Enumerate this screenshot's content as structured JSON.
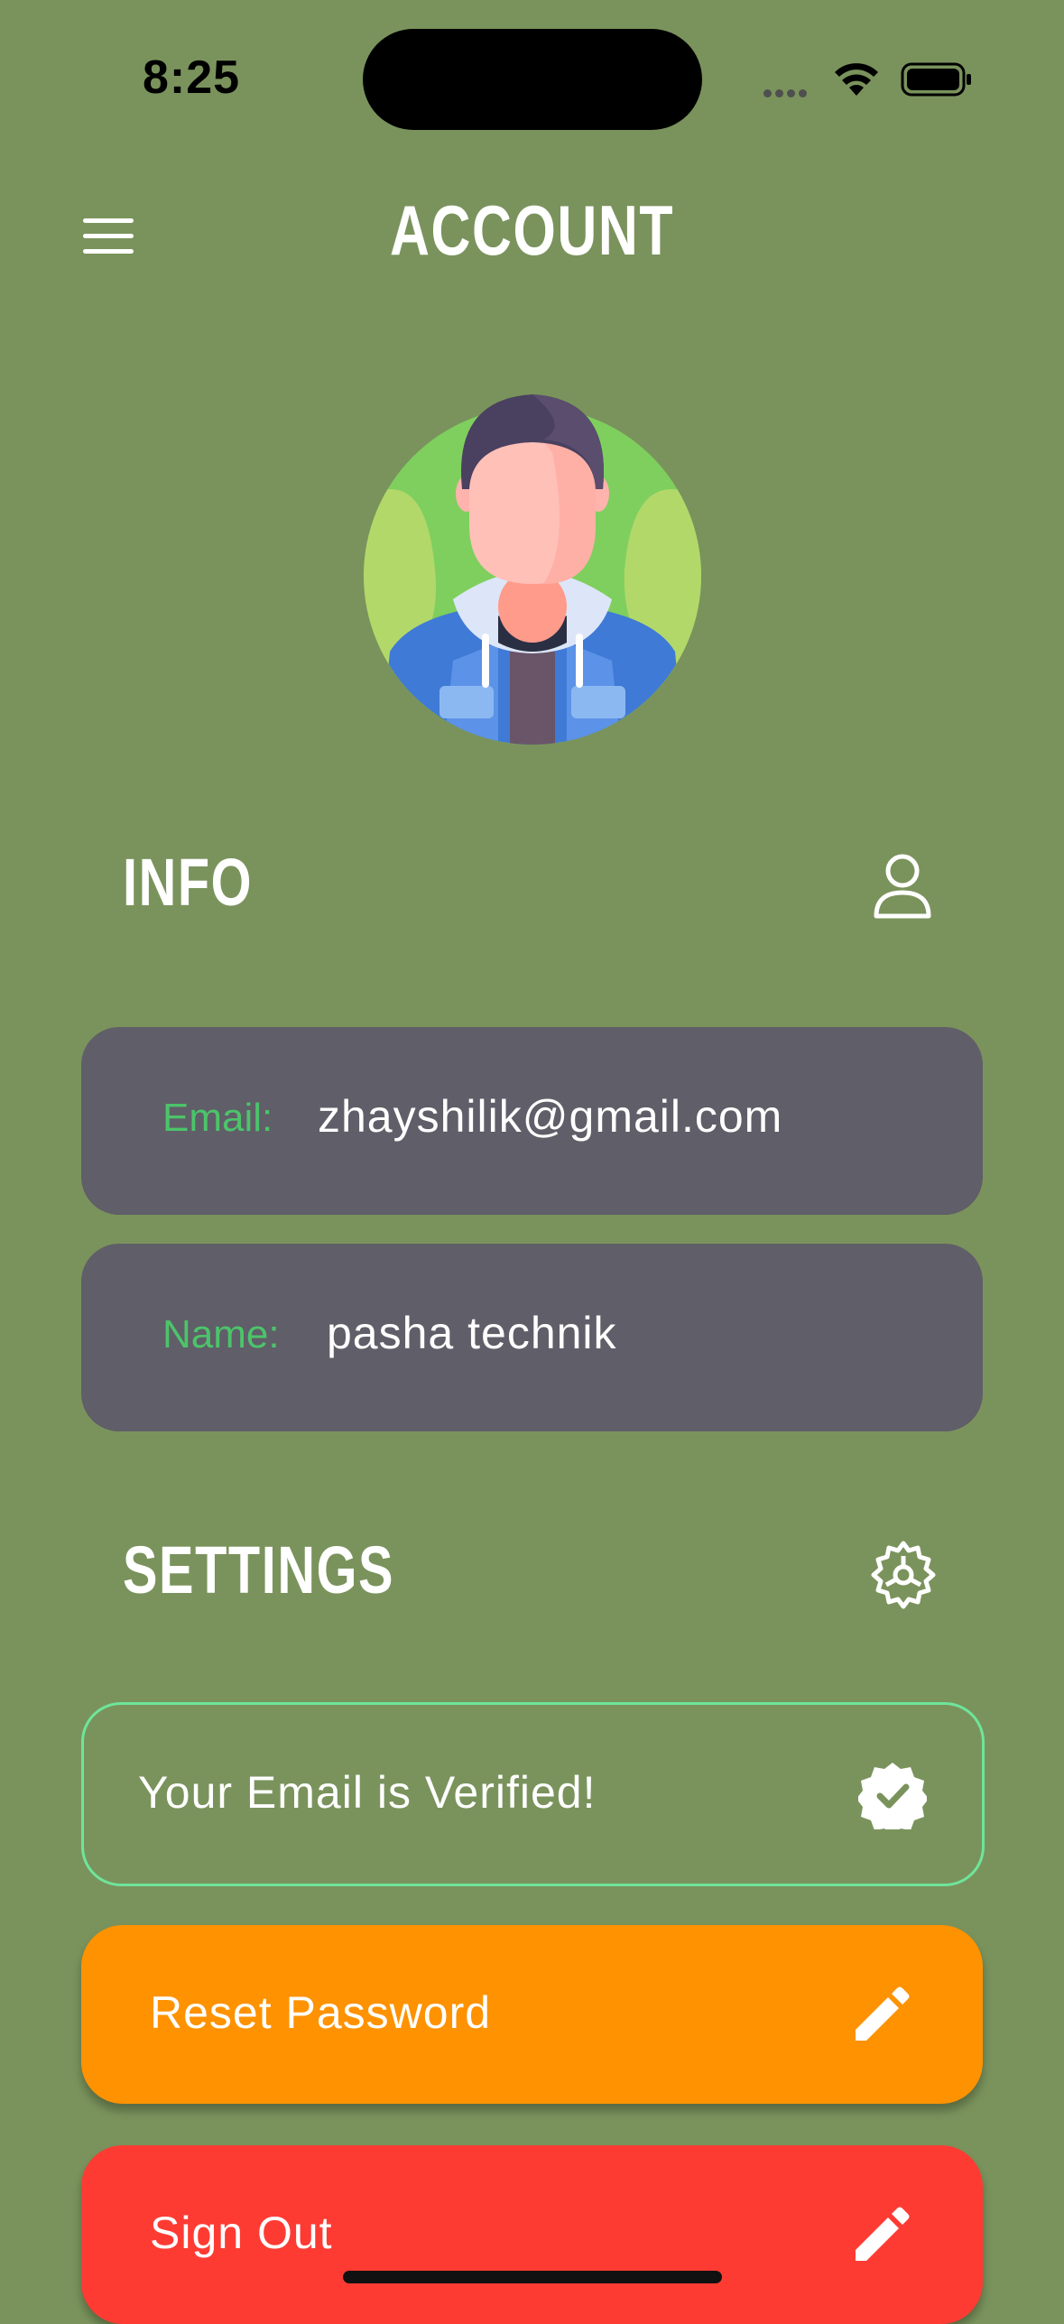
{
  "status_bar": {
    "time": "8:25"
  },
  "header": {
    "title": "ACCOUNT"
  },
  "info": {
    "heading": "INFO",
    "email_label": "Email:",
    "email_value": "zhayshilik@gmail.com",
    "name_label": "Name:",
    "name_value": "pasha technik"
  },
  "settings": {
    "heading": "SETTINGS",
    "verified_text": "Your Email is Verified!",
    "reset_label": "Reset Password",
    "signout_label": "Sign Out"
  },
  "icons": {
    "menu": "hamburger-menu-icon",
    "info": "person-outline-icon",
    "settings": "gear-icon",
    "verified": "verified-badge-icon",
    "edit": "pencil-icon"
  },
  "colors": {
    "background": "#7a935c",
    "card": "#605e68",
    "label_green": "#4cc46a",
    "verified_border": "#6ee59a",
    "reset_button": "#fe9200",
    "signout_button": "#fe3b33"
  }
}
